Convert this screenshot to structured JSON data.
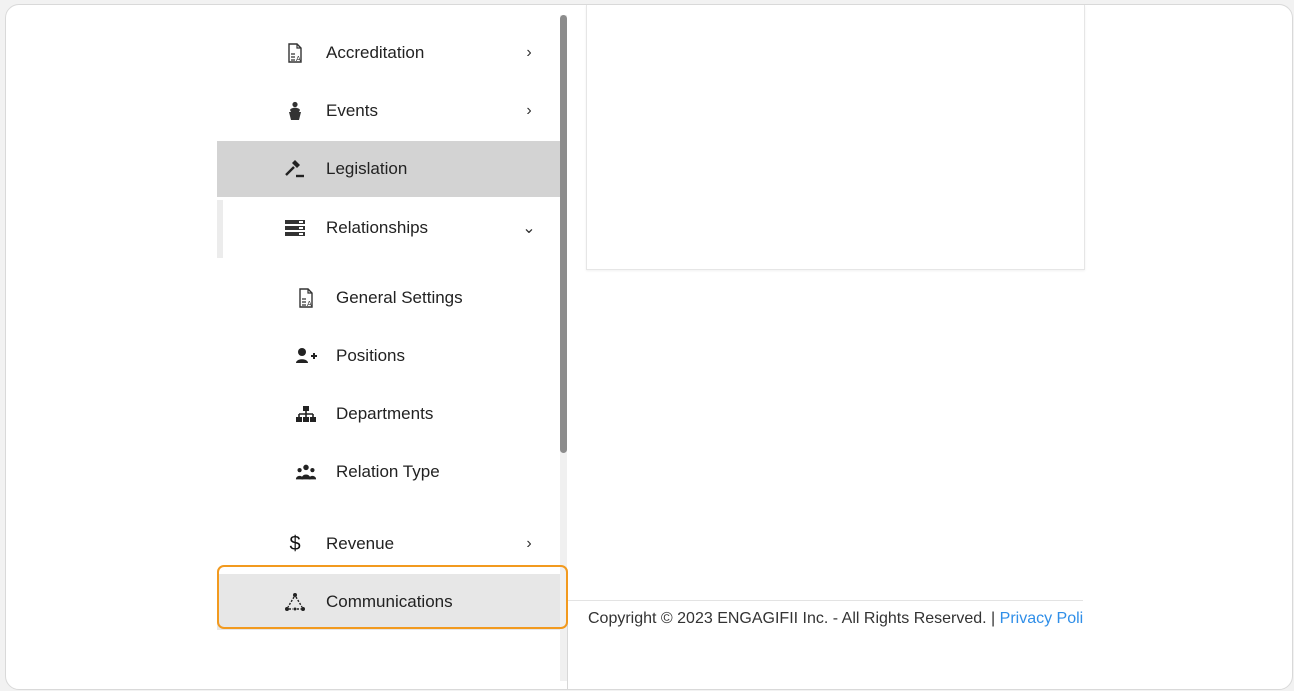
{
  "sidebar": {
    "items": [
      {
        "label": "Accreditation",
        "icon": "document-a-icon",
        "chevron": "›"
      },
      {
        "label": "Events",
        "icon": "speaker-podium-icon",
        "chevron": "›"
      },
      {
        "label": "Legislation",
        "icon": "gavel-icon",
        "chevron": ""
      },
      {
        "label": "Relationships",
        "icon": "server-stack-icon",
        "chevron": "⌄"
      }
    ],
    "sub_items": [
      {
        "label": "General Settings",
        "icon": "document-a-icon"
      },
      {
        "label": "Positions",
        "icon": "user-plus-icon"
      },
      {
        "label": "Departments",
        "icon": "org-chart-icon"
      },
      {
        "label": "Relation Type",
        "icon": "group-icon"
      }
    ],
    "lower_items": [
      {
        "label": "Revenue",
        "icon": "dollar-icon",
        "chevron": "›"
      },
      {
        "label": "Communications",
        "icon": "network-icon",
        "chevron": ""
      }
    ],
    "active_item": "Legislation",
    "highlighted_item": "Communications"
  },
  "footer": {
    "copyright": "Copyright © 2023 ENGAGIFII Inc. - All Rights Reserved. | ",
    "link": "Privacy Policy"
  },
  "colors": {
    "highlight_border": "#f29a1f",
    "active_bg": "#d3d3d3",
    "link": "#2f8ee8"
  }
}
